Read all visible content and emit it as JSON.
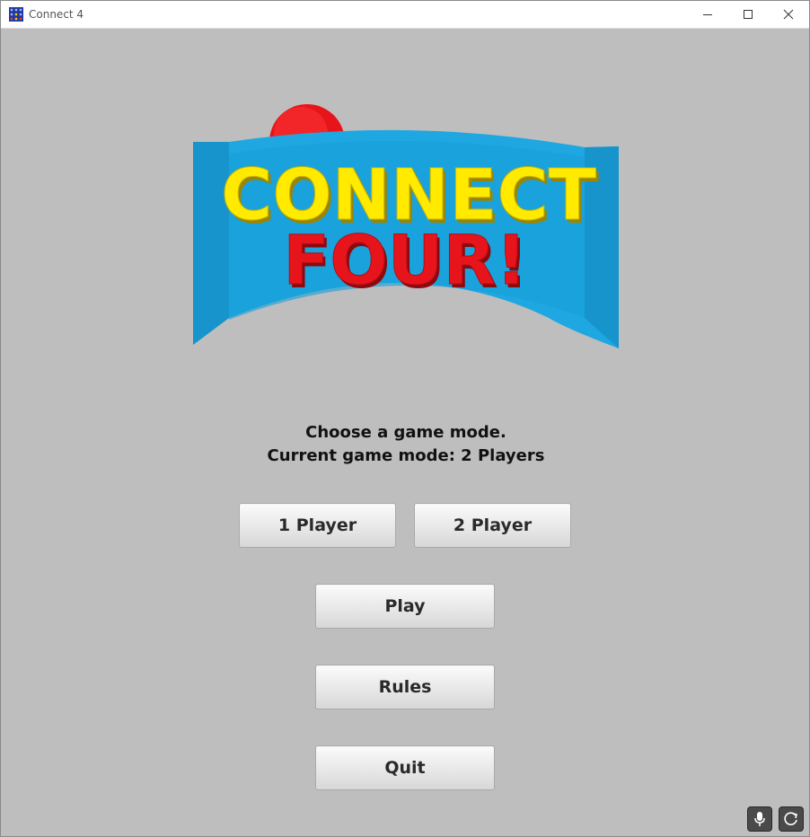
{
  "window": {
    "title": "Connect 4",
    "controls": {
      "minimize": "minimize",
      "maximize": "maximize",
      "close": "close"
    }
  },
  "logo": {
    "line1": "CONNECT",
    "line2": "FOUR!"
  },
  "mode": {
    "prompt": "Choose a game mode.",
    "current": "Current game mode: 2 Players"
  },
  "buttons": {
    "one_player": "1 Player",
    "two_player": "2 Player",
    "play": "Play",
    "rules": "Rules",
    "quit": "Quit"
  },
  "colors": {
    "background": "#bebebe",
    "banner_blue": "#1ea7e1",
    "title_yellow": "#ffea00",
    "title_red": "#e8141c",
    "disc_red": "#e8141c"
  },
  "icons": {
    "tray_left": "microphone-icon",
    "tray_right": "refresh-icon"
  }
}
